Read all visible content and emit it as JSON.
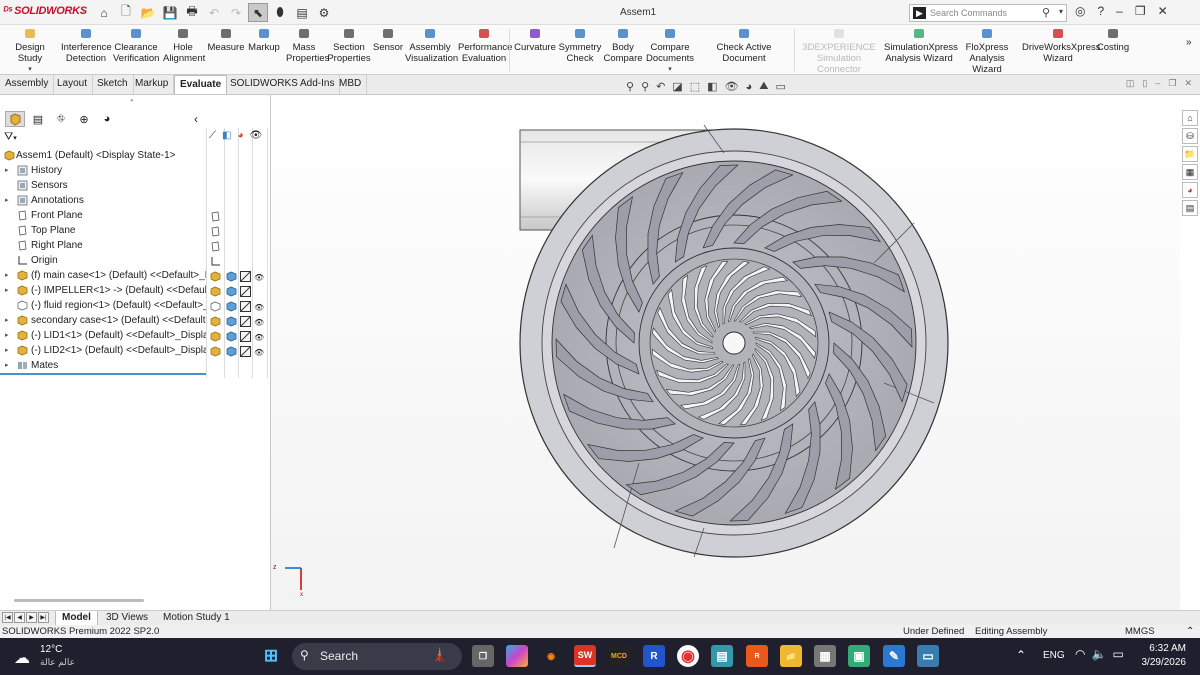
{
  "app": {
    "logo_text": "SOLIDWORKS",
    "window_title": "Assem1"
  },
  "search": {
    "placeholder": "Search Commands"
  },
  "commands": [
    {
      "label": "Design Study",
      "icon": "design-study-icon",
      "has_arrow": true
    },
    {
      "label": "Interference Detection",
      "icon": "interference-icon"
    },
    {
      "label": "Clearance Verification",
      "icon": "clearance-icon"
    },
    {
      "label": "Hole Alignment",
      "icon": "hole-icon"
    },
    {
      "label": "Measure",
      "icon": "measure-icon"
    },
    {
      "label": "Markup",
      "icon": "markup-icon"
    },
    {
      "label": "Mass Properties",
      "icon": "mass-icon"
    },
    {
      "label": "Section Properties",
      "icon": "section-icon"
    },
    {
      "label": "Sensor",
      "icon": "sensor-icon"
    },
    {
      "label": "Assembly Visualization",
      "icon": "assembly-vis-icon"
    },
    {
      "label": "Performance Evaluation",
      "icon": "performance-icon"
    },
    {
      "label": "Curvature",
      "icon": "curvature-icon"
    },
    {
      "label": "Symmetry Check",
      "icon": "symmetry-icon"
    },
    {
      "label": "Body Compare",
      "icon": "body-compare-icon"
    },
    {
      "label": "Compare Documents",
      "icon": "compare-docs-icon",
      "has_arrow": true
    },
    {
      "label": "Check Active Document",
      "icon": "check-doc-icon"
    },
    {
      "label": "3DEXPERIENCE Simulation Connector",
      "icon": "connector-icon",
      "disabled": true
    },
    {
      "label": "SimulationXpress Analysis Wizard",
      "icon": "simxpress-icon"
    },
    {
      "label": "FloXpress Analysis Wizard",
      "icon": "floxpress-icon"
    },
    {
      "label": "DriveWorksXpress Wizard",
      "icon": "driveworks-icon"
    },
    {
      "label": "Costing",
      "icon": "costing-icon"
    }
  ],
  "tabs": [
    "Assembly",
    "Layout",
    "Sketch",
    "Markup",
    "Evaluate",
    "SOLIDWORKS Add-Ins",
    "MBD"
  ],
  "active_tab": "Evaluate",
  "tree": {
    "root": "Assem1 (Default) <Display State-1>",
    "items": [
      {
        "label": "History",
        "icon": "history-icon",
        "expandable": true
      },
      {
        "label": "Sensors",
        "icon": "sensors-icon",
        "expandable": false
      },
      {
        "label": "Annotations",
        "icon": "annotations-icon",
        "expandable": true
      },
      {
        "label": "Front Plane",
        "icon": "plane-icon",
        "expandable": false
      },
      {
        "label": "Top Plane",
        "icon": "plane-icon",
        "expandable": false
      },
      {
        "label": "Right Plane",
        "icon": "plane-icon",
        "expandable": false
      },
      {
        "label": "Origin",
        "icon": "origin-icon",
        "expandable": false
      },
      {
        "label": "(f) main case<1> (Default) <<Default>_Di",
        "icon": "part-icon",
        "expandable": true
      },
      {
        "label": "(-) IMPELLER<1> -> (Default) <<Default>",
        "icon": "part-icon",
        "expandable": true
      },
      {
        "label": "(-) fluid region<1> (Default) <<Default>_",
        "icon": "part-outline-icon",
        "expandable": false
      },
      {
        "label": "secondary case<1> (Default) <<Default>_",
        "icon": "part-icon",
        "expandable": true
      },
      {
        "label": "(-) LID1<1> (Default) <<Default>_Display",
        "icon": "part-icon",
        "expandable": true
      },
      {
        "label": "(-) LID2<1> (Default) <<Default>_Display",
        "icon": "part-icon",
        "expandable": true
      },
      {
        "label": "Mates",
        "icon": "mates-icon",
        "expandable": true
      }
    ]
  },
  "bottom_tabs": [
    "Model",
    "3D Views",
    "Motion Study 1"
  ],
  "active_bottom_tab": "Model",
  "status": {
    "product": "SOLIDWORKS Premium 2022 SP2.0",
    "state": "Under Defined",
    "mode": "Editing Assembly",
    "units": "MMGS"
  },
  "taskbar": {
    "weather_temp": "12°C",
    "weather_text": "عالم عالة",
    "search_label": "Search",
    "lang": "ENG",
    "time": "6:32 AM",
    "date": "3/29/2026"
  },
  "colors": {
    "brand_red": "#c8102e",
    "accent_blue": "#4b8fd0",
    "taskbar": "#1f1f2e"
  }
}
